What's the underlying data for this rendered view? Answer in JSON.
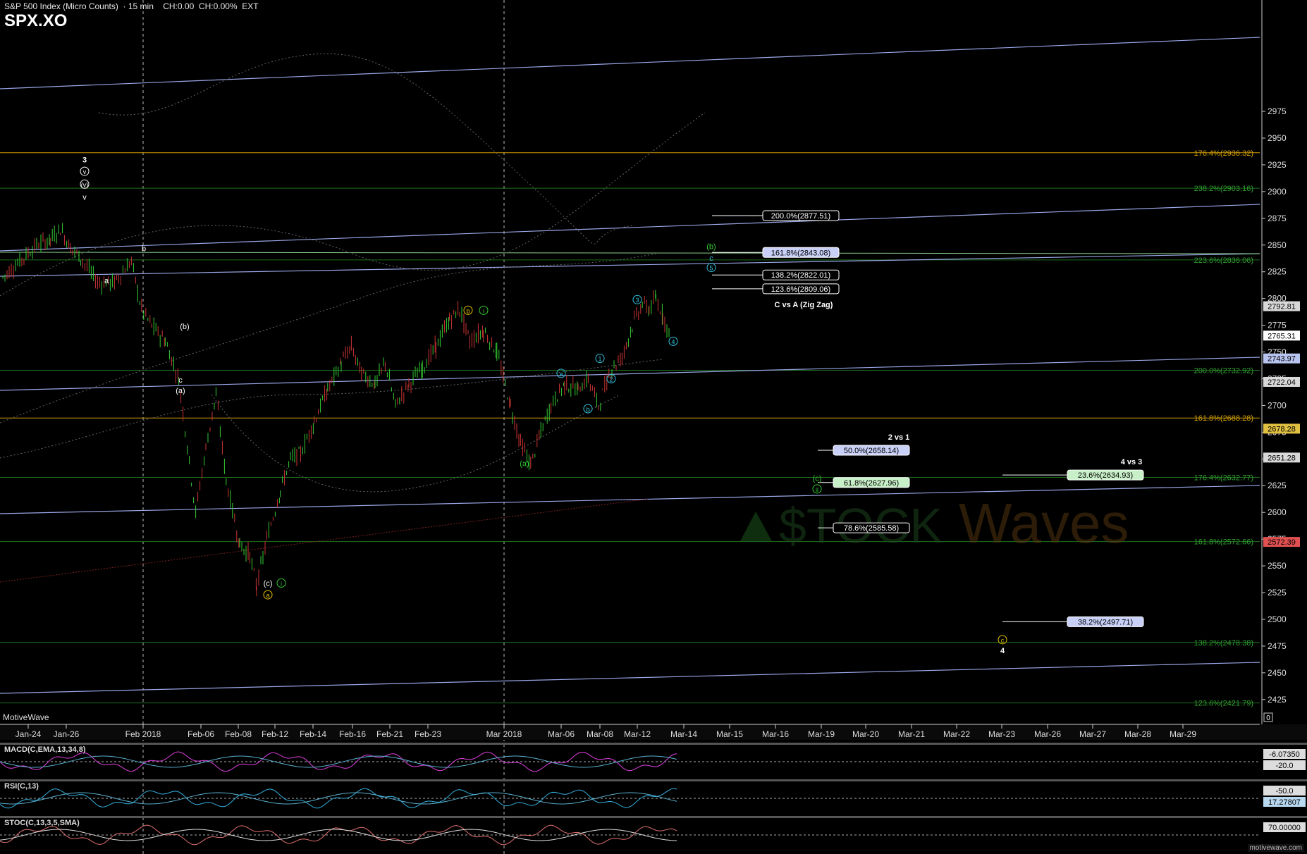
{
  "header": {
    "title": "S&P 500 Index (Micro Counts)  · 15 min",
    "change_text": "CH:0.00  CH:0.00%  EXT",
    "symbol": "SPX.XO",
    "vendor": "MotiveWave",
    "footer": "motivewave.com"
  },
  "colors": {
    "background": "#000000",
    "candle_up": "#33cc33",
    "candle_down": "#cc3333",
    "channel": "#9aa6e6",
    "fib_green": "#1e7a1e",
    "fib_yellow": "#d4a000",
    "label_cyan": "#33c4e0",
    "label_green": "#33cc33",
    "label_yellow": "#e6c200"
  },
  "chart_data": {
    "type": "candlestick",
    "title": "S&P 500 Index (Micro Counts) · 15 min",
    "ylim": [
      2400,
      2985
    ],
    "grid": false,
    "y_ticks": [
      2425,
      2450,
      2475,
      2500,
      2525,
      2550,
      2575,
      2600,
      2625,
      2650,
      2675,
      2700,
      2725,
      2750,
      2775,
      2800,
      2825,
      2850,
      2875,
      2900,
      2925,
      2950,
      2975
    ],
    "x_tick_labels": [
      "Jan-24",
      "Jan-26",
      "Feb 2018",
      "Feb-06",
      "Feb-08",
      "Feb-12",
      "Feb-14",
      "Feb-16",
      "Feb-21",
      "Feb-23",
      "Mar 2018",
      "Mar-06",
      "Mar-08",
      "Mar-12",
      "Mar-14",
      "Mar-15",
      "Mar-16",
      "Mar-19",
      "Mar-20",
      "Mar-21",
      "Mar-22",
      "Mar-23",
      "Mar-26",
      "Mar-27",
      "Mar-28",
      "Mar-29"
    ],
    "price_path": [
      [
        0,
        2820
      ],
      [
        0.5,
        2835
      ],
      [
        1,
        2850
      ],
      [
        1.4,
        2855
      ],
      [
        1.7,
        2865
      ],
      [
        2,
        2848
      ],
      [
        2.3,
        2838
      ],
      [
        2.8,
        2815
      ],
      [
        3.3,
        2815
      ],
      [
        3.8,
        2835
      ],
      [
        4.1,
        2790
      ],
      [
        4.4,
        2775
      ],
      [
        4.8,
        2760
      ],
      [
        5.2,
        2725
      ],
      [
        5.7,
        2600
      ],
      [
        6,
        2660
      ],
      [
        6.3,
        2710
      ],
      [
        6.6,
        2630
      ],
      [
        7,
        2570
      ],
      [
        7.3,
        2560
      ],
      [
        7.5,
        2530
      ],
      [
        7.8,
        2575
      ],
      [
        8.2,
        2620
      ],
      [
        8.5,
        2650
      ],
      [
        8.8,
        2655
      ],
      [
        9.2,
        2685
      ],
      [
        9.6,
        2715
      ],
      [
        10,
        2740
      ],
      [
        10.3,
        2755
      ],
      [
        10.6,
        2730
      ],
      [
        11,
        2720
      ],
      [
        11.3,
        2740
      ],
      [
        11.6,
        2700
      ],
      [
        12,
        2720
      ],
      [
        12.4,
        2735
      ],
      [
        12.8,
        2755
      ],
      [
        13.2,
        2780
      ],
      [
        13.5,
        2790
      ],
      [
        13.8,
        2760
      ],
      [
        14.2,
        2770
      ],
      [
        14.6,
        2750
      ],
      [
        15,
        2700
      ],
      [
        15.3,
        2665
      ],
      [
        15.6,
        2645
      ],
      [
        15.9,
        2675
      ],
      [
        16.2,
        2700
      ],
      [
        16.6,
        2720
      ],
      [
        17,
        2715
      ],
      [
        17.3,
        2725
      ],
      [
        17.6,
        2700
      ],
      [
        18,
        2735
      ],
      [
        18.3,
        2745
      ],
      [
        18.6,
        2775
      ],
      [
        18.9,
        2795
      ],
      [
        19.1,
        2790
      ],
      [
        19.3,
        2800
      ],
      [
        19.5,
        2785
      ],
      [
        19.7,
        2765
      ]
    ],
    "price_labels": [
      {
        "value": "2792.81",
        "price": 2792.81,
        "bg": "#d8d8d8",
        "fg": "#000"
      },
      {
        "value": "2765.31",
        "price": 2765.31,
        "bg": "#ffffff",
        "fg": "#000"
      },
      {
        "value": "2743.97",
        "price": 2743.97,
        "bg": "#b8c4f0",
        "fg": "#000"
      },
      {
        "value": "2722.04",
        "price": 2722.04,
        "bg": "#d8d8d8",
        "fg": "#000"
      },
      {
        "value": "2678.28",
        "price": 2678.28,
        "bg": "#e0c040",
        "fg": "#000"
      },
      {
        "value": "2651.28",
        "price": 2651.28,
        "bg": "#d8d8d8",
        "fg": "#000"
      },
      {
        "value": "2572.39",
        "price": 2572.39,
        "bg": "#e05050",
        "fg": "#000"
      }
    ],
    "fib_levels": [
      {
        "label": "176.4%(2936.32)",
        "price": 2936.32,
        "color": "#d4a000",
        "text": "#d4a000"
      },
      {
        "label": "238.2%(2903.16)",
        "price": 2903.16,
        "color": "#1e6e1e",
        "text": "#2ea02e"
      },
      {
        "label": "223.6%(2836.06)",
        "price": 2836.06,
        "color": "#1e6e1e",
        "text": "#2ea02e"
      },
      {
        "label": "200.0%(2732.92)",
        "price": 2732.92,
        "color": "#1e6e1e",
        "text": "#2ea02e"
      },
      {
        "label": "161.8%(2688.28)",
        "price": 2688.28,
        "color": "#d4a000",
        "text": "#d4a000"
      },
      {
        "label": "176.4%(2632.77)",
        "price": 2632.77,
        "color": "#1e6e1e",
        "text": "#2ea02e"
      },
      {
        "label": "161.8%(2572.66)",
        "price": 2572.66,
        "color": "#1e6e1e",
        "text": "#2ea02e"
      },
      {
        "label": "138.2%(2478.38)",
        "price": 2478.38,
        "color": "#1e6e1e",
        "text": "#2ea02e"
      },
      {
        "label": "123.6%(2421.79)",
        "price": 2421.79,
        "color": "#1e6e1e",
        "text": "#2ea02e"
      }
    ],
    "target_boxes": [
      {
        "label": "200.0%(2877.51)",
        "price": 2877.51,
        "bg": "#000",
        "fg": "#fff",
        "border": "#fff"
      },
      {
        "label": "161.8%(2843.08)",
        "price": 2843.08,
        "bg": "#c8d0f8",
        "fg": "#000",
        "border": "#fff"
      },
      {
        "label": "138.2%(2822.01)",
        "price": 2822.01,
        "bg": "#000",
        "fg": "#fff",
        "border": "#fff"
      },
      {
        "label": "123.6%(2809.06)",
        "price": 2809.06,
        "bg": "#000",
        "fg": "#fff",
        "border": "#fff"
      },
      {
        "label": "50.0%(2658.14)",
        "price": 2658.14,
        "bg": "#c8d0f8",
        "fg": "#000",
        "border": "#fff"
      },
      {
        "label": "61.8%(2627.96)",
        "price": 2627.96,
        "bg": "#c8f0c8",
        "fg": "#000",
        "border": "#fff"
      },
      {
        "label": "78.6%(2585.58)",
        "price": 2585.58,
        "bg": "#000",
        "fg": "#fff",
        "border": "#fff"
      },
      {
        "label": "23.6%(2634.93)",
        "price": 2634.93,
        "bg": "#c8f0c8",
        "fg": "#000",
        "border": "#fff"
      },
      {
        "label": "38.2%(2497.71)",
        "price": 2497.71,
        "bg": "#c8d0f8",
        "fg": "#000",
        "border": "#fff"
      }
    ],
    "annotations": [
      {
        "text": "C vs A (Zig Zag)",
        "price": 2792
      },
      {
        "text": "2 vs 1",
        "price": 2668
      },
      {
        "text": "4 vs 3",
        "price": 2645
      }
    ],
    "wave_labels": [
      {
        "text": "3",
        "price": 2928
      },
      {
        "text": "v",
        "price": 2917
      },
      {
        "text": "(v)",
        "price": 2905
      },
      {
        "text": "v",
        "price": 2893
      },
      {
        "text": "b",
        "price": 2845
      },
      {
        "text": "a",
        "price": 2815
      },
      {
        "text": "(b)",
        "price": 2772
      },
      {
        "text": "c",
        "price": 2722
      },
      {
        "text": "(a)",
        "price": 2712
      },
      {
        "text": "(c)",
        "price": 2532
      },
      {
        "text": "i",
        "price": 2532
      },
      {
        "text": "a",
        "price": 2521
      },
      {
        "text": "b",
        "price": 2787
      },
      {
        "text": "i",
        "price": 2787
      },
      {
        "text": "(a)",
        "price": 2644
      },
      {
        "text": "a",
        "price": 2728
      },
      {
        "text": "b",
        "price": 2695
      },
      {
        "text": "1",
        "price": 2742
      },
      {
        "text": "2",
        "price": 2723
      },
      {
        "text": "3",
        "price": 2797
      },
      {
        "text": "4",
        "price": 2758
      },
      {
        "text": "(b)",
        "price": 2847
      },
      {
        "text": "c",
        "price": 2836
      },
      {
        "text": "5",
        "price": 2827
      },
      {
        "text": "(c)",
        "price": 2630
      },
      {
        "text": "ii",
        "price": 2620
      },
      {
        "text": "c",
        "price": 2479
      },
      {
        "text": "4",
        "price": 2469
      }
    ],
    "indicators": [
      {
        "name": "MACD(C,EMA,13,34,8)",
        "values": [
          "-6.07350",
          "-20.0"
        ]
      },
      {
        "name": "RSI(C,13)",
        "values": [
          "-50.0",
          "17.27807"
        ]
      },
      {
        "name": "STOC(C,13,3,5,SMA)",
        "values": [
          "70.00000"
        ]
      }
    ],
    "x_value_zero": "0"
  }
}
